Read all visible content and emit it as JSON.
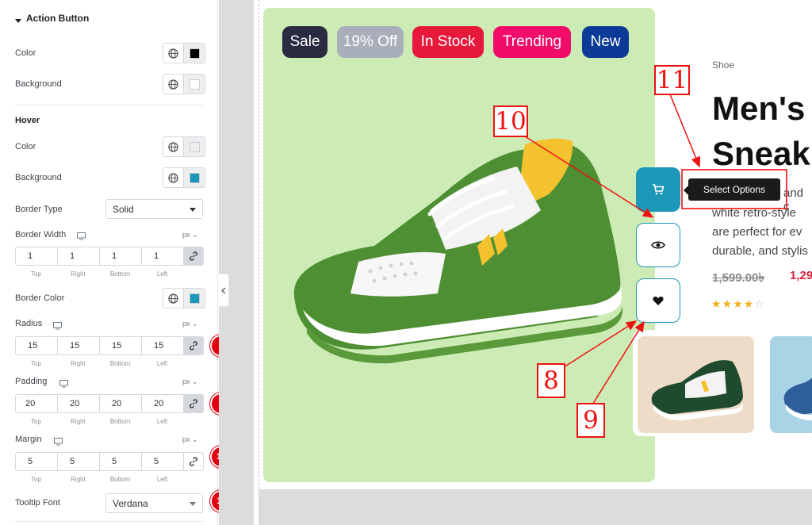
{
  "panel": {
    "section_title": "Action Button",
    "color_label": "Color",
    "background_label": "Background",
    "hover_title": "Hover",
    "hover_color_label": "Color",
    "hover_background_label": "Background",
    "border_type_label": "Border Type",
    "border_type_value": "Solid",
    "border_width_label": "Border Width",
    "border_width_unit": "px",
    "border_width": {
      "top": "1",
      "right": "1",
      "bottom": "1",
      "left": "1"
    },
    "border_color_label": "Border Color",
    "radius_label": "Radius",
    "radius_unit": "px",
    "radius": {
      "top": "15",
      "right": "15",
      "bottom": "15",
      "left": "15"
    },
    "padding_label": "Padding",
    "padding_unit": "px",
    "padding": {
      "top": "20",
      "right": "20",
      "bottom": "20",
      "left": "20"
    },
    "margin_label": "Margin",
    "margin_unit": "px",
    "margin": {
      "top": "5",
      "right": "5",
      "bottom": "5",
      "left": "5"
    },
    "tooltip_font_label": "Tooltip Font",
    "tooltip_font_value": "Verdana",
    "side_labels": {
      "top": "Top",
      "right": "Right",
      "bottom": "Bottom",
      "left": "Left"
    },
    "badges": {
      "b8": "8",
      "b9": "9",
      "b10": "10",
      "b11": "11"
    },
    "colors": {
      "color_swatch": "#000000",
      "background_swatch": "#ffffff",
      "hover_color_swatch": "#eeeeee",
      "hover_background_swatch": "#1d97b7",
      "border_color_swatch": "#1d97b7"
    }
  },
  "preview": {
    "tags": [
      "Sale",
      "19% Off",
      "In Stock",
      "Trending",
      "New"
    ],
    "tag_colors": [
      "#2a2a40",
      "#a9aebb",
      "#e6193b",
      "#f20c6a",
      "#0b3b96"
    ],
    "category": "Shoe",
    "title_line1": "Men's",
    "title_line2": "Sneak",
    "desc_line1": "and c",
    "desc_line2": "white retro-style",
    "desc_line3": "are perfect for ev",
    "desc_line4": "durable, and stylis",
    "old_price": "1,599.00৳",
    "new_price": "1,29",
    "rating": 4,
    "tooltip": "Select Options",
    "annotations": {
      "a8": "8",
      "a9": "9",
      "a10": "10",
      "a11": "11"
    },
    "icons": {
      "cart": "cart-icon",
      "eye": "eye-icon",
      "heart": "heart-icon"
    }
  }
}
